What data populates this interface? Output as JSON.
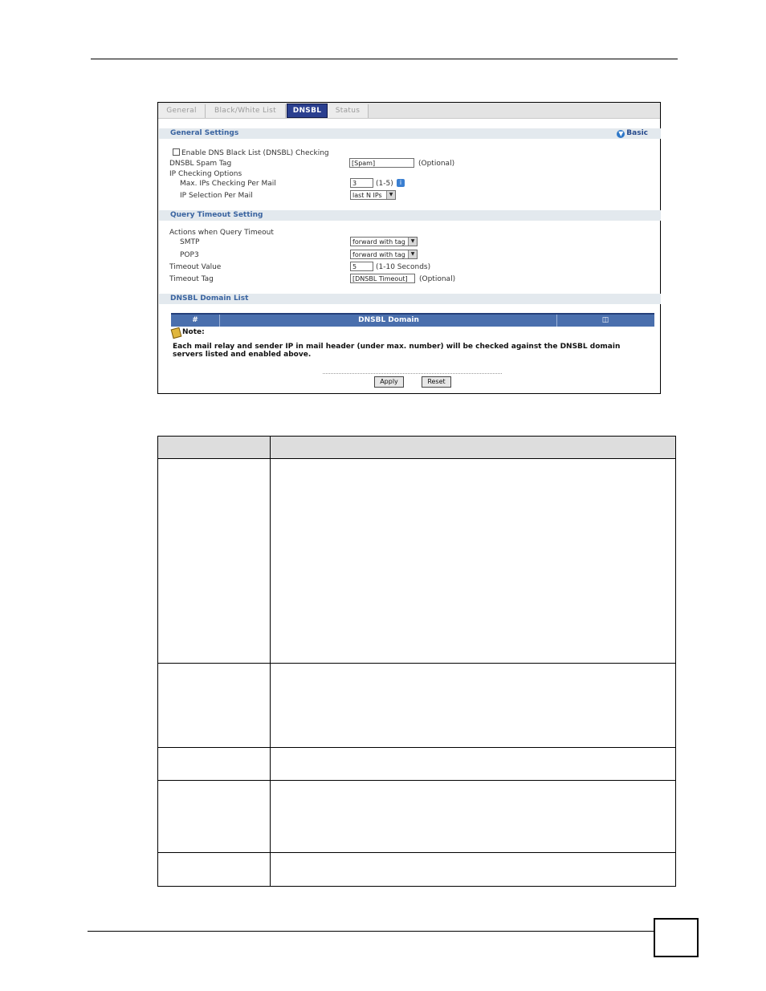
{
  "tabs": [
    {
      "label": "General",
      "active": false
    },
    {
      "label": "Black/White List",
      "active": false
    },
    {
      "label": "DNSBL",
      "active": true
    },
    {
      "label": "Status",
      "active": false
    }
  ],
  "general_settings": {
    "title": "General Settings",
    "basic_link": "Basic",
    "enable_label": "Enable DNS Black List (DNSBL) Checking",
    "enable_checked": false,
    "spam_tag_label": "DNSBL Spam Tag",
    "spam_tag_value": "[Spam]",
    "spam_tag_hint": "(Optional)",
    "ip_checking_label": "IP Checking Options",
    "max_ips_label": "Max. IPs Checking Per Mail",
    "max_ips_value": "3",
    "max_ips_hint": "(1-5)",
    "ip_selection_label": "IP Selection Per Mail",
    "ip_selection_value": "last N IPs"
  },
  "query_timeout": {
    "title": "Query Timeout Setting",
    "actions_label": "Actions when Query Timeout",
    "smtp_label": "SMTP",
    "smtp_value": "forward with tag",
    "pop3_label": "POP3",
    "pop3_value": "forward with tag",
    "timeout_value_label": "Timeout Value",
    "timeout_value": "5",
    "timeout_value_hint": "(1-10 Seconds)",
    "timeout_tag_label": "Timeout Tag",
    "timeout_tag_value": "[DNSBL Timeout]",
    "timeout_tag_hint": "(Optional)"
  },
  "domain_list": {
    "title": "DNSBL Domain List",
    "columns": [
      "#",
      "DNSBL Domain"
    ],
    "note_label": "Note:",
    "note_text": "Each mail relay and sender IP in mail header (under max. number) will be checked against the DNSBL domain servers listed and enabled above."
  },
  "buttons": {
    "apply": "Apply",
    "reset": "Reset"
  }
}
